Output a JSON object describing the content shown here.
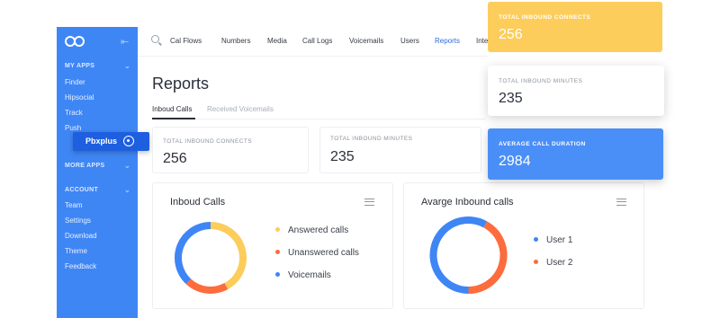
{
  "colors": {
    "sidebar": "#3f86f5",
    "accent": "#2f6bd8",
    "yellow": "#fccd5b",
    "blue": "#4a8ff7",
    "orange": "#fd6c3d",
    "donut_blue": "#3f86f5"
  },
  "sidebar": {
    "my_apps": "MY APPS",
    "apps": [
      "Finder",
      "Hipsocial",
      "Track",
      "Push"
    ],
    "active_app": "Pbxplus",
    "more_apps": "MORE APPS",
    "account": "ACCOUNT",
    "account_items": [
      "Team",
      "Settings",
      "Download",
      "Theme",
      "Feedback"
    ]
  },
  "topnav": [
    "Cal Flows",
    "Numbers",
    "Media",
    "Call Logs",
    "Voicemails",
    "Users",
    "Reports",
    "Inte"
  ],
  "page": {
    "title": "Reports",
    "tabs": [
      "Inboud Calls",
      "Received Voicemails"
    ]
  },
  "stats": [
    {
      "label": "TOTAL INBOUND CONNECTS",
      "value": "256"
    },
    {
      "label": "TOTAL INBOUND MINUTES",
      "value": "235"
    }
  ],
  "floating": [
    {
      "label": "TOTAL INBOUND CONNECTS",
      "value": "256"
    },
    {
      "label": "TOTAL INBOUND MINUTES",
      "value": "235"
    },
    {
      "label": "AVERAGE CALL DURATION",
      "value": "2984"
    }
  ],
  "chart_data": [
    {
      "type": "pie",
      "title": "Inboud Calls",
      "series": [
        {
          "name": "Answered calls",
          "value": 42,
          "color": "#fccd5b"
        },
        {
          "name": "Unanswered calls",
          "value": 20,
          "color": "#fd6c3d"
        },
        {
          "name": "Voicemails",
          "value": 38,
          "color": "#3f86f5"
        }
      ]
    },
    {
      "type": "pie",
      "title": "Avarge Inbound calls",
      "series": [
        {
          "name": "User 1",
          "value": 58,
          "color": "#3f86f5"
        },
        {
          "name": "User 2",
          "value": 42,
          "color": "#fd6c3d"
        }
      ]
    }
  ]
}
